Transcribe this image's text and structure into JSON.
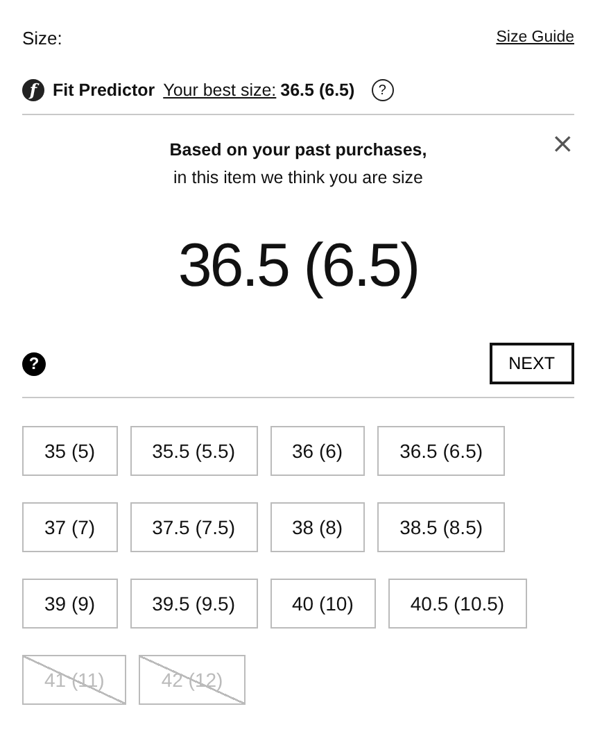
{
  "size_label": "Size:",
  "size_guide_link": "Size Guide",
  "fit_predictor": {
    "logo": "f",
    "title": "Fit Predictor",
    "best_size_link": "Your best size:",
    "best_size": "36.5 (6.5)",
    "help": "?"
  },
  "recommendation": {
    "heading": "Based on your past purchases,",
    "subheading": "in this item we think you are size",
    "size": "36.5 (6.5)",
    "close": "×",
    "help": "?",
    "next_button": "NEXT"
  },
  "sizes": [
    {
      "label": "35 (5)",
      "available": true
    },
    {
      "label": "35.5 (5.5)",
      "available": true
    },
    {
      "label": "36 (6)",
      "available": true
    },
    {
      "label": "36.5 (6.5)",
      "available": true
    },
    {
      "label": "37 (7)",
      "available": true
    },
    {
      "label": "37.5 (7.5)",
      "available": true
    },
    {
      "label": "38 (8)",
      "available": true
    },
    {
      "label": "38.5 (8.5)",
      "available": true
    },
    {
      "label": "39 (9)",
      "available": true
    },
    {
      "label": "39.5 (9.5)",
      "available": true
    },
    {
      "label": "40 (10)",
      "available": true
    },
    {
      "label": "40.5 (10.5)",
      "available": true
    },
    {
      "label": "41 (11)",
      "available": false
    },
    {
      "label": "42 (12)",
      "available": false
    }
  ]
}
